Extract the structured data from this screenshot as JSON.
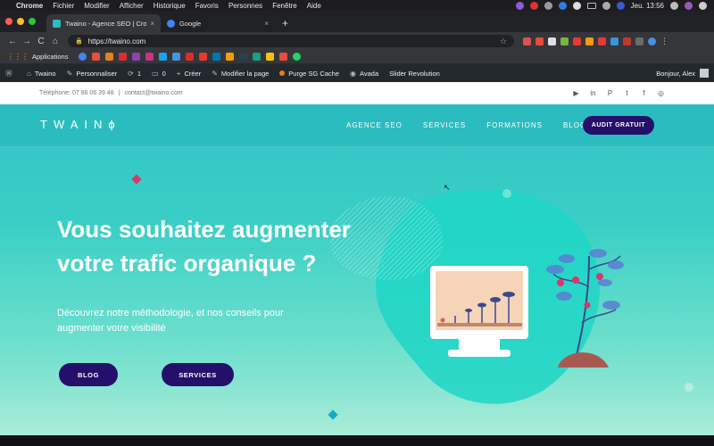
{
  "menubar": {
    "apple": "",
    "items": [
      "Chrome",
      "Fichier",
      "Modifier",
      "Afficher",
      "Historique",
      "Favoris",
      "Personnes",
      "Fenêtre",
      "Aide"
    ],
    "clock": "Jeu. 13:56",
    "icon_colors": [
      "#8e5bd6",
      "#d33",
      "#999",
      "#2b7de9",
      "#ddd",
      "#aaa"
    ]
  },
  "browser": {
    "tabs": [
      {
        "title": "Twaino - Agence SEO | Croissa",
        "favicon_color": "#2bbcbf",
        "active": true
      },
      {
        "title": "Google",
        "favicon_color": "#4285f4",
        "active": false
      }
    ],
    "close_glyph": "×",
    "new_tab_glyph": "+",
    "url": "https://twaino.com",
    "lock_glyph": "🔒",
    "star_glyph": "☆",
    "nav_glyphs": {
      "back": "←",
      "forward": "→",
      "reload": "C",
      "home": "⌂"
    },
    "extension_colors": [
      "#d9534f",
      "#e74c3c",
      "#e0e0e0",
      "#7cb342",
      "#e53935",
      "#f39c12",
      "#e53935",
      "#3498db",
      "#c0392b",
      "#6c6c6c",
      "#4a90e2"
    ],
    "bookmarks_label": "Applications",
    "bookmarks_grid_glyph": "⋮⋮⋮",
    "bookmark_colors": [
      "#4285f4",
      "#e74c3c",
      "#e67e22",
      "#d32f2f",
      "#8e44ad",
      "#c13584",
      "#1da1f2",
      "#4a90e2",
      "#d32f2f",
      "#e53935",
      "#0077b5",
      "#f39c12",
      "#2c3e50",
      "#16a085",
      "#f1c40f",
      "#e74c3c",
      "#25d366"
    ]
  },
  "wpbar": {
    "wp_glyph": "Ⓦ",
    "site_glyph": "⌂",
    "site": "Twaino",
    "customize_glyph": "✎",
    "customize": "Personnaliser",
    "updates_glyph": "⟳",
    "updates": "1",
    "comments_glyph": "▭",
    "comments": "0",
    "create_glyph": "+",
    "create": "Créer",
    "edit_glyph": "✎",
    "edit": "Modifier la page",
    "purge": "Purge SG Cache",
    "avada_glyph": "◉",
    "avada": "Avada",
    "slider": "Slider Revolution",
    "greeting": "Bonjour, Alex"
  },
  "site": {
    "phone": "Téléphone: 07 86 06 39 48",
    "separator": "|",
    "email": "contact@twaino.com",
    "social_glyphs": [
      "▶",
      "in",
      "P",
      "t",
      "f",
      "◎"
    ],
    "logo": "TWAIN",
    "logo_mark": "ϕ",
    "nav": [
      "AGENCE SEO",
      "SERVICES",
      "FORMATIONS",
      "BLOG"
    ],
    "cta": "AUDIT GRATUIT",
    "hero_title": "Vous souhaitez augmenter votre trafic organique ?",
    "hero_subtitle": "Découvrez notre méthodologie, et nos conseils pour augmenter votre visibilité",
    "btn_blog": "BLOG",
    "btn_services": "SERVICES"
  },
  "colors": {
    "teal": "#2bbcbf",
    "navy": "#24106b",
    "pink": "#e0336c"
  }
}
